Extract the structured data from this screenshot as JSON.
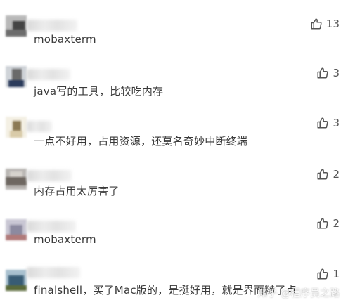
{
  "comments": [
    {
      "text": "mobaxterm",
      "likes": "13"
    },
    {
      "text": "java写的工具，比较吃内存",
      "likes": "3"
    },
    {
      "text": "一点不好用，占用资源，还莫名奇妙中断终端",
      "likes": "3"
    },
    {
      "text": "内存占用太厉害了",
      "likes": "2"
    },
    {
      "text": "mobaxterm",
      "likes": "2"
    },
    {
      "text": "finalshell，买了Mac版的，是挺好用，就是界面糙了点",
      "likes": "1"
    }
  ],
  "watermark": "知乎 @程序员之路",
  "colors": {
    "text": "#3a3a3a",
    "icon": "#555555",
    "blur": "#e3e3e3"
  },
  "icons": {
    "like": "thumbs-up-icon"
  }
}
